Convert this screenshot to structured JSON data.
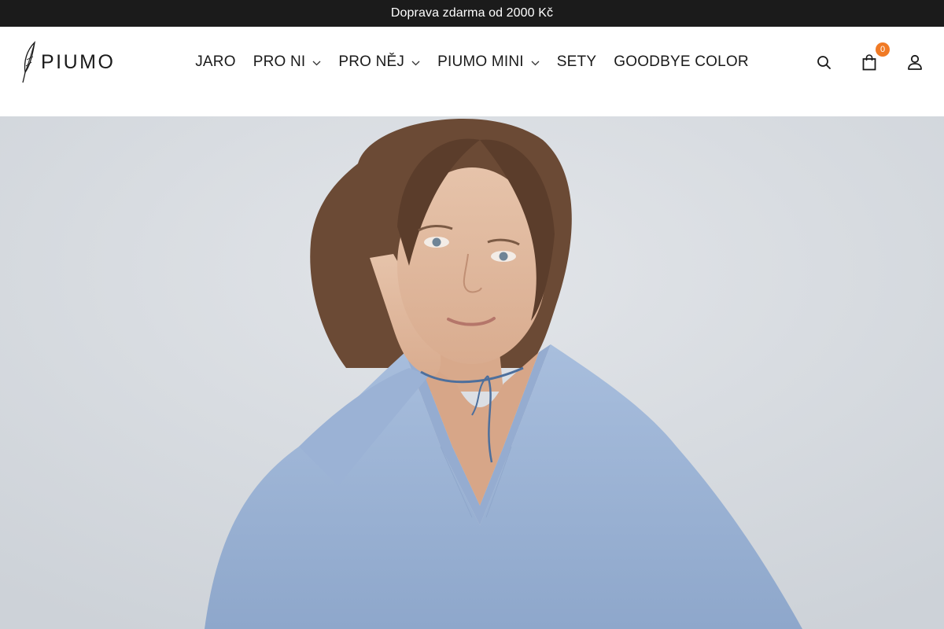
{
  "announcement": {
    "text": "Doprava zdarma od 2000 Kč"
  },
  "brand": {
    "name": "PIUMO"
  },
  "nav": {
    "items": [
      {
        "label": "JARO",
        "has_dropdown": false
      },
      {
        "label": "PRO NI",
        "has_dropdown": true
      },
      {
        "label": "PRO NĚJ",
        "has_dropdown": true
      },
      {
        "label": "PIUMO MINI",
        "has_dropdown": true
      },
      {
        "label": "SETY",
        "has_dropdown": false
      },
      {
        "label": "GOODBYE COLOR",
        "has_dropdown": false
      }
    ]
  },
  "actions": {
    "search_icon": "search-icon",
    "cart_icon": "shopping-bag-icon",
    "cart_count": "0",
    "account_icon": "user-icon"
  },
  "colors": {
    "announcement_bg": "#1b1b1b",
    "badge": "#f07a25",
    "hero_bg": "#d9dde2",
    "sweater": "#9fb5d6"
  }
}
